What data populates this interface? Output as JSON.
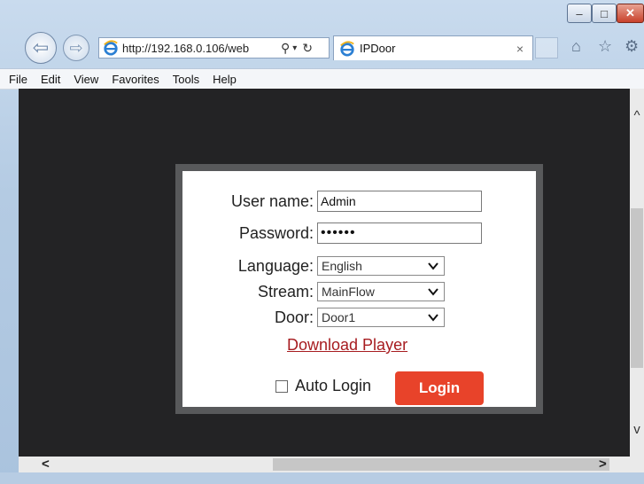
{
  "browser": {
    "address_url": "http://192.168.0.106/web",
    "tab_title": "IPDoor",
    "tab_close": "×",
    "nav": {
      "back": "⇦",
      "forward": "⇨"
    },
    "address_glyphs": {
      "search": "⚲",
      "dropdown": "▾",
      "refresh": "↻"
    },
    "toolbar_glyphs": {
      "home": "⌂",
      "favorites": "☆",
      "tools": "⚙"
    },
    "caption": {
      "minimize": "–",
      "maximize": "□",
      "close": "✕"
    },
    "menu": [
      "File",
      "Edit",
      "View",
      "Favorites",
      "Tools",
      "Help"
    ],
    "scroll_glyphs": {
      "up": "^",
      "down": "v",
      "left": "<",
      "right": ">"
    }
  },
  "login": {
    "username_label": "User name:",
    "username_value": "Admin",
    "password_label": "Password:",
    "password_value": "••••••",
    "language_label": "Language:",
    "language_value": "English",
    "stream_label": "Stream:",
    "stream_value": "MainFlow",
    "door_label": "Door:",
    "door_value": "Door1",
    "download_link": "Download Player",
    "autologin_label": "Auto Login",
    "login_button": "Login"
  },
  "colors": {
    "content_bg": "#232325",
    "panel_border": "#58595b",
    "login_button": "#e8432a",
    "link": "#a71c20"
  }
}
